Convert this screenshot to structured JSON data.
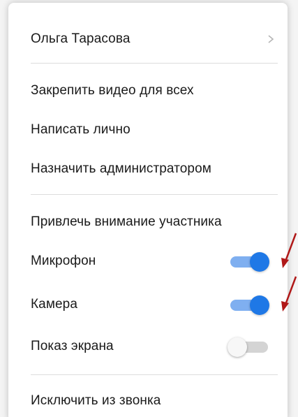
{
  "menu": {
    "participant_name": "Ольга Тарасова",
    "items": {
      "pin_video": "Закрепить видео для всех",
      "message_private": "Написать лично",
      "make_admin": "Назначить администратором",
      "attract_attention": "Привлечь внимание участника",
      "remove_from_call": "Исключить из звонка"
    },
    "toggles": {
      "microphone": {
        "label": "Микрофон",
        "on": true
      },
      "camera": {
        "label": "Камера",
        "on": true
      },
      "screen_share": {
        "label": "Показ экрана",
        "on": false
      }
    }
  },
  "colors": {
    "toggle_on_knob": "#1f78e6",
    "toggle_on_track": "#7faff0",
    "toggle_off_track": "#d4d4d4",
    "annotation_arrow": "#b01818"
  },
  "icons": {
    "chevron": "chevron-right-icon",
    "annotation": "arrow-icon"
  }
}
